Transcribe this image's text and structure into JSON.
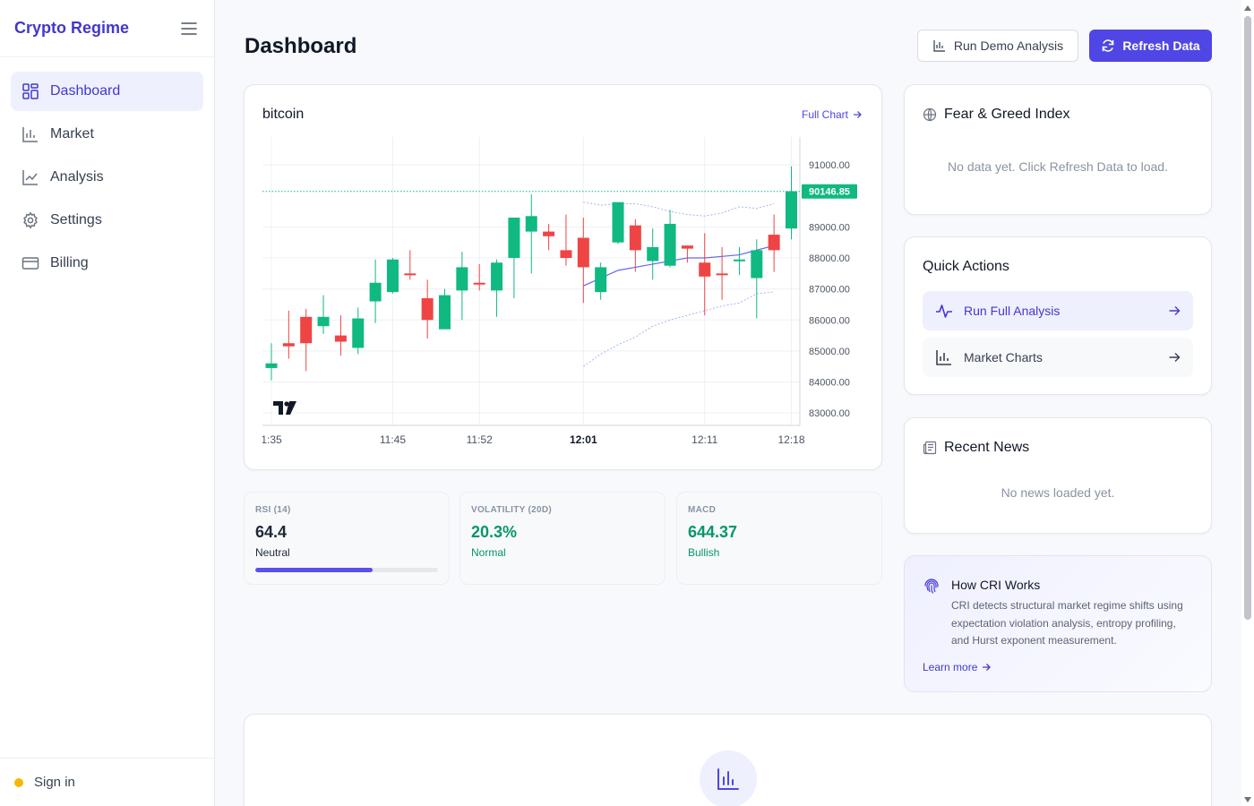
{
  "sidebar": {
    "brand": "Crypto Regime",
    "items": [
      {
        "label": "Dashboard",
        "icon": "dashboard-grid-icon",
        "active": true
      },
      {
        "label": "Market",
        "icon": "bar-chart-icon"
      },
      {
        "label": "Analysis",
        "icon": "line-chart-icon"
      },
      {
        "label": "Settings",
        "icon": "gear-icon"
      },
      {
        "label": "Billing",
        "icon": "credit-card-icon"
      }
    ],
    "sign_in": "Sign in",
    "status_color": "#f5b800"
  },
  "header": {
    "title": "Dashboard",
    "demo_button": "Run Demo Analysis",
    "refresh_button": "Refresh Data"
  },
  "chart_card": {
    "title": "bitcoin",
    "full_chart_link": "Full Chart",
    "watermark": "TV"
  },
  "chart_data": {
    "type": "candlestick",
    "title": "bitcoin",
    "y_ticks": [
      91000,
      89000,
      88000,
      87000,
      86000,
      85000,
      84000,
      83000
    ],
    "y_tick_labels": [
      "91000.00",
      "89000.00",
      "88000.00",
      "87000.00",
      "86000.00",
      "85000.00",
      "84000.00",
      "83000.00"
    ],
    "ylim": [
      82600,
      91900
    ],
    "x_labels": [
      {
        "label": "1:35",
        "index": 0,
        "bold": false
      },
      {
        "label": "11:45",
        "index": 7,
        "bold": false
      },
      {
        "label": "11:52",
        "index": 12,
        "bold": false
      },
      {
        "label": "12:01",
        "index": 18,
        "bold": true
      },
      {
        "label": "12:11",
        "index": 25,
        "bold": false
      },
      {
        "label": "12:18",
        "index": 30,
        "bold": false
      }
    ],
    "last_price": 90146.85,
    "last_price_label": "90146.85",
    "up_color": "#10b981",
    "down_color": "#ef4444",
    "candles": [
      {
        "o": 84450,
        "h": 85250,
        "l": 84050,
        "c": 84600
      },
      {
        "o": 85250,
        "h": 86300,
        "l": 84750,
        "c": 85150
      },
      {
        "o": 86100,
        "h": 86350,
        "l": 84350,
        "c": 85250
      },
      {
        "o": 85800,
        "h": 86800,
        "l": 85550,
        "c": 86100
      },
      {
        "o": 85500,
        "h": 86150,
        "l": 84850,
        "c": 85300
      },
      {
        "o": 85100,
        "h": 86400,
        "l": 84900,
        "c": 86050
      },
      {
        "o": 86600,
        "h": 87950,
        "l": 85900,
        "c": 87200
      },
      {
        "o": 86900,
        "h": 88000,
        "l": 86850,
        "c": 87950
      },
      {
        "o": 87500,
        "h": 88250,
        "l": 87300,
        "c": 87450
      },
      {
        "o": 86700,
        "h": 87300,
        "l": 85400,
        "c": 86000
      },
      {
        "o": 85700,
        "h": 87000,
        "l": 85700,
        "c": 86800
      },
      {
        "o": 86950,
        "h": 88200,
        "l": 86000,
        "c": 87700
      },
      {
        "o": 87200,
        "h": 87800,
        "l": 86950,
        "c": 87150
      },
      {
        "o": 86950,
        "h": 87950,
        "l": 86100,
        "c": 87850
      },
      {
        "o": 88000,
        "h": 89250,
        "l": 86700,
        "c": 89300
      },
      {
        "o": 88850,
        "h": 90050,
        "l": 87500,
        "c": 89350
      },
      {
        "o": 88850,
        "h": 89100,
        "l": 88250,
        "c": 88700
      },
      {
        "o": 88250,
        "h": 89400,
        "l": 87750,
        "c": 88000
      },
      {
        "o": 88650,
        "h": 89300,
        "l": 86550,
        "c": 87700
      },
      {
        "o": 86900,
        "h": 87850,
        "l": 86650,
        "c": 87700
      },
      {
        "o": 88500,
        "h": 89700,
        "l": 88450,
        "c": 89800
      },
      {
        "o": 89050,
        "h": 89250,
        "l": 87550,
        "c": 88250
      },
      {
        "o": 87900,
        "h": 88950,
        "l": 87300,
        "c": 88350
      },
      {
        "o": 87750,
        "h": 89550,
        "l": 87700,
        "c": 89100
      },
      {
        "o": 88400,
        "h": 88350,
        "l": 87850,
        "c": 88300
      },
      {
        "o": 87850,
        "h": 88800,
        "l": 86150,
        "c": 87400
      },
      {
        "o": 87500,
        "h": 88350,
        "l": 86650,
        "c": 87450
      },
      {
        "o": 87950,
        "h": 88350,
        "l": 87450,
        "c": 87950
      },
      {
        "o": 87350,
        "h": 88600,
        "l": 86050,
        "c": 88250
      },
      {
        "o": 88750,
        "h": 89400,
        "l": 87550,
        "c": 88250
      },
      {
        "o": 88950,
        "h": 90950,
        "l": 88600,
        "c": 90150
      }
    ],
    "ma_start_index": 18,
    "ma_line": [
      87100,
      87350,
      87600,
      87700,
      87800,
      87900,
      88000,
      88000,
      88050,
      88100,
      88250,
      88400
    ],
    "bb_upper": [
      89800,
      89700,
      89750,
      89750,
      89650,
      89500,
      89400,
      89350,
      89450,
      89650,
      89600,
      89750
    ],
    "bb_lower": [
      84500,
      84900,
      85200,
      85450,
      85800,
      86000,
      86150,
      86300,
      86450,
      86550,
      86850,
      86900
    ]
  },
  "stats": [
    {
      "label": "RSI (14)",
      "value": "64.4",
      "sub": "Neutral",
      "color": "#1f2937",
      "sub_color": "#1f2937",
      "progress": 0.64
    },
    {
      "label": "VOLATILITY (20D)",
      "value": "20.3%",
      "sub": "Normal",
      "color": "#059669",
      "sub_color": "#059669"
    },
    {
      "label": "MACD",
      "value": "644.37",
      "sub": "Bullish",
      "color": "#059669",
      "sub_color": "#059669"
    }
  ],
  "fear_greed": {
    "title": "Fear & Greed Index",
    "empty": "No data yet. Click Refresh Data to load."
  },
  "quick_actions": {
    "title": "Quick Actions",
    "items": [
      {
        "label": "Run Full Analysis",
        "icon": "activity-icon",
        "active": true
      },
      {
        "label": "Market Charts",
        "icon": "bar-chart-icon"
      }
    ]
  },
  "news": {
    "title": "Recent News",
    "empty": "No news loaded yet."
  },
  "info": {
    "title": "How CRI Works",
    "body": "CRI detects structural market regime shifts using expectation violation analysis, entropy profiling, and Hurst exponent measurement.",
    "link": "Learn more"
  },
  "colors": {
    "accent": "#4f46e5",
    "brand": "#4338ca",
    "up": "#10b981",
    "down": "#ef4444"
  }
}
